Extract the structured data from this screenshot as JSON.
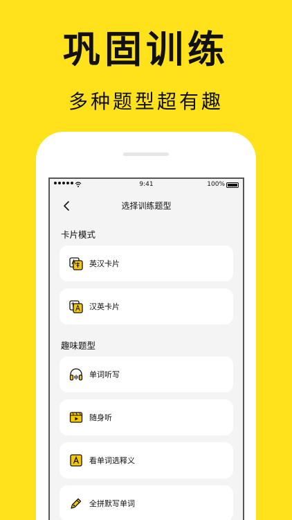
{
  "headline": "巩固训练",
  "subline": "多种题型超有趣",
  "status_bar": {
    "time": "9:41",
    "battery_text": "100%"
  },
  "nav": {
    "title": "选择训练题型"
  },
  "sections": [
    {
      "title": "卡片模式",
      "items": [
        {
          "label": "英汉卡片",
          "icon": "card-en-zh-icon"
        },
        {
          "label": "汉英卡片",
          "icon": "card-zh-en-icon"
        }
      ]
    },
    {
      "title": "趣味题型",
      "items": [
        {
          "label": "单词听写",
          "icon": "headphones-icon"
        },
        {
          "label": "随身听",
          "icon": "video-play-icon"
        },
        {
          "label": "看单词选释义",
          "icon": "letter-a-icon"
        },
        {
          "label": "全拼默写单词",
          "icon": "pen-icon"
        }
      ]
    }
  ],
  "colors": {
    "background": "#FFE21C",
    "accent": "#F5C800",
    "text": "#111111"
  }
}
